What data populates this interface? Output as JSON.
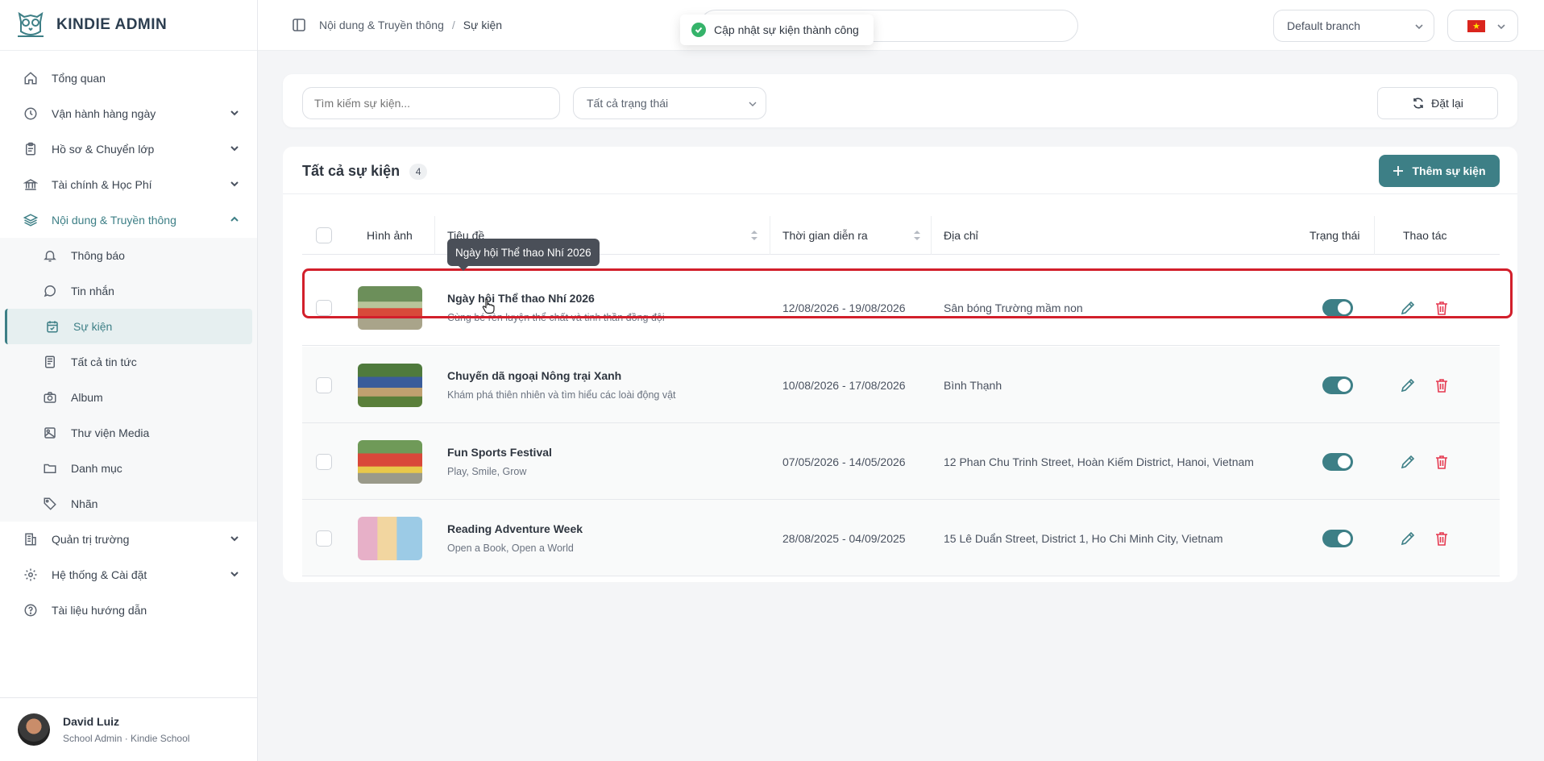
{
  "brand": {
    "name": "KINDIE ADMIN"
  },
  "sidebar": {
    "items": [
      {
        "label": "Tổng quan",
        "icon": "home-icon"
      },
      {
        "label": "Vận hành hàng ngày",
        "icon": "clock-icon"
      },
      {
        "label": "Hồ sơ & Chuyển lớp",
        "icon": "clipboard-icon"
      },
      {
        "label": "Tài chính & Học Phí",
        "icon": "bank-icon"
      },
      {
        "label": "Nội dung & Truyền thông",
        "icon": "layers-icon"
      }
    ],
    "sub_items": [
      {
        "label": "Thông báo",
        "icon": "bell-icon"
      },
      {
        "label": "Tin nhắn",
        "icon": "message-icon"
      },
      {
        "label": "Sự kiện",
        "icon": "calendar-icon"
      },
      {
        "label": "Tất cả tin tức",
        "icon": "newspaper-icon"
      },
      {
        "label": "Album",
        "icon": "camera-icon"
      },
      {
        "label": "Thư viện Media",
        "icon": "image-icon"
      },
      {
        "label": "Danh mục",
        "icon": "folder-icon"
      },
      {
        "label": "Nhãn",
        "icon": "tag-icon"
      }
    ],
    "bottom_items": [
      {
        "label": "Quản trị trường",
        "icon": "building-icon"
      },
      {
        "label": "Hệ thống & Cài đặt",
        "icon": "gear-icon"
      },
      {
        "label": "Tài liệu hướng dẫn",
        "icon": "help-icon"
      }
    ]
  },
  "user": {
    "name": "David Luiz",
    "role": "School Admin · Kindie School"
  },
  "topbar": {
    "breadcrumb": {
      "parent": "Nội dung & Truyền thông",
      "separator": "/",
      "current": "Sự kiện"
    },
    "toast": "Cập nhật sự kiện thành công",
    "branch": "Default branch"
  },
  "filters": {
    "search_placeholder": "Tìm kiếm sự kiện...",
    "status": "Tất cả trạng thái",
    "reset_label": "Đặt lại"
  },
  "list": {
    "title": "Tất cả sự kiện",
    "count": "4",
    "add_label": "Thêm sự kiện",
    "columns": {
      "image": "Hình ảnh",
      "title": "Tiêu đề",
      "time": "Thời gian diễn ra",
      "address": "Địa chỉ",
      "status": "Trạng thái",
      "actions": "Thao tác"
    },
    "rows": [
      {
        "title": "Ngày hội Thể thao Nhí 2026",
        "subtitle": "Cùng bé rèn luyện thể chất và tinh thần đồng đội",
        "time": "12/08/2026 - 19/08/2026",
        "address": "Sân bóng Trường mầm non",
        "active": true
      },
      {
        "title": "Chuyến dã ngoại Nông trại Xanh",
        "subtitle": "Khám phá thiên nhiên và tìm hiểu các loài động vật",
        "time": "10/08/2026 - 17/08/2026",
        "address": "Bình Thạnh",
        "active": true
      },
      {
        "title": "Fun Sports Festival",
        "subtitle": "Play, Smile, Grow",
        "time": "07/05/2026 - 14/05/2026",
        "address": "12 Phan Chu Trinh Street, Hoàn Kiếm District, Hanoi, Vietnam",
        "active": true
      },
      {
        "title": "Reading Adventure Week",
        "subtitle": "Open a Book, Open a World",
        "time": "28/08/2025 - 04/09/2025",
        "address": "15 Lê Duẩn Street, District 1, Ho Chi Minh City, Vietnam",
        "active": true
      }
    ]
  },
  "tooltip": "Ngày hội Thể thao Nhí 2026",
  "colors": {
    "accent": "#3d7f86",
    "danger": "#e53950",
    "highlight": "#d21f2b",
    "success": "#35b36a"
  }
}
